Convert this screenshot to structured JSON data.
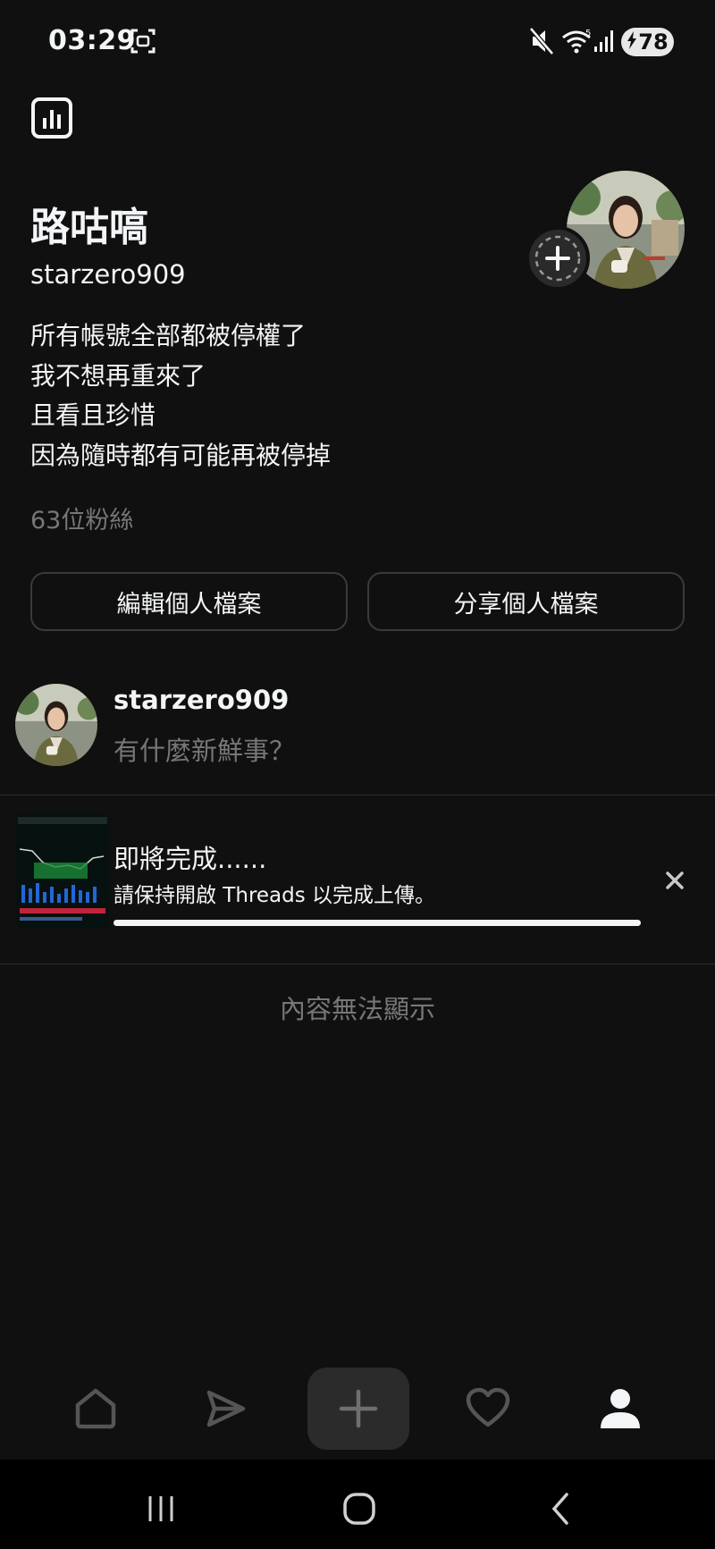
{
  "status_bar": {
    "time": "03:29",
    "battery": "78",
    "icons": [
      "screenshot-icon",
      "mute-icon",
      "wifi-icon",
      "signal-icon",
      "battery-charging-icon"
    ]
  },
  "profile": {
    "display_name": "路咕嗃",
    "username": "starzero909",
    "bio": [
      "所有帳號全部都被停權了",
      "我不想再重來了",
      "且看且珍惜",
      "因為隨時都有可能再被停掉"
    ],
    "followers": "63位粉絲",
    "edit_button": "編輯個人檔案",
    "share_button": "分享個人檔案"
  },
  "composer": {
    "username": "starzero909",
    "placeholder": "有什麼新鮮事？"
  },
  "upload": {
    "title": "即將完成......",
    "subtitle": "請保持開啟 Threads 以完成上傳。",
    "progress": 1.0
  },
  "feed": {
    "empty_text": "內容無法顯示"
  },
  "bottom_nav": {
    "items": [
      "home-icon",
      "send-icon",
      "create-icon",
      "heart-icon",
      "profile-icon"
    ],
    "active": "profile-icon"
  },
  "colors": {
    "background": "#101010",
    "text": "#f3f5f7",
    "muted": "#777777",
    "border": "#3a3a3a"
  }
}
